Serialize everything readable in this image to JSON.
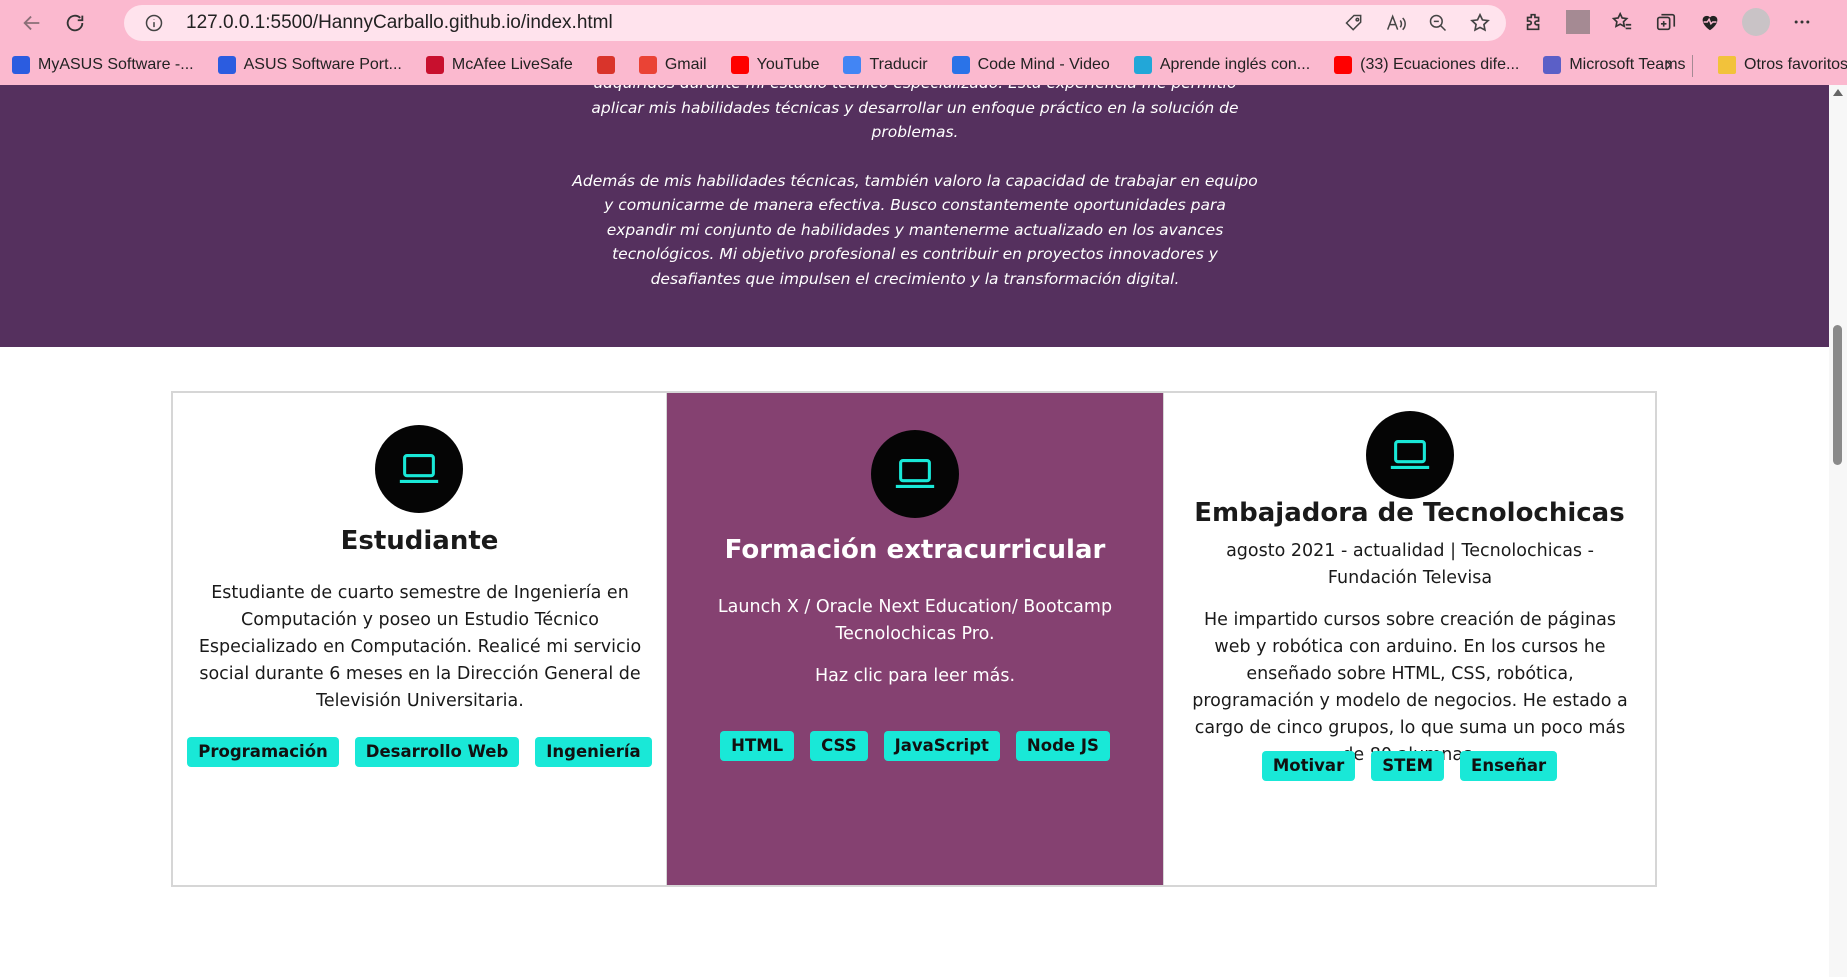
{
  "browser": {
    "url": "127.0.0.1:5500/HannyCarballo.github.io/index.html",
    "bookmarks": [
      {
        "label": "MyASUS Software -...",
        "color": "#2b5ce0"
      },
      {
        "label": "ASUS Software Port...",
        "color": "#2b5ce0"
      },
      {
        "label": "McAfee LiveSafe",
        "color": "#c8102e"
      },
      {
        "label": "",
        "color": "#d9342b"
      },
      {
        "label": "Gmail",
        "color": "#ea4335"
      },
      {
        "label": "YouTube",
        "color": "#ff0000"
      },
      {
        "label": "Traducir",
        "color": "#4285f4"
      },
      {
        "label": "Code Mind - Video",
        "color": "#2a73e8"
      },
      {
        "label": "Aprende inglés con...",
        "color": "#22a7d8"
      },
      {
        "label": "(33) Ecuaciones dife...",
        "color": "#ff0000"
      },
      {
        "label": "Microsoft Teams",
        "color": "#5b5fc7"
      }
    ],
    "other_favorites": "Otros favoritos"
  },
  "about": {
    "paragraph1_tail": "adquiridos durante mi estudio técnico especializado. Esta experiencia me permitió aplicar mis habilidades técnicas y desarrollar un enfoque práctico en la solución de problemas.",
    "paragraph2": "Además de mis habilidades técnicas, también valoro la capacidad de trabajar en equipo y comunicarme de manera efectiva. Busco constantemente oportunidades para expandir mi conjunto de habilidades y mantenerme actualizado en los avances tecnológicos. Mi objetivo profesional es contribuir en proyectos innovadores y desafiantes que impulsen el crecimiento y la transformación digital."
  },
  "cards": [
    {
      "title": "Estudiante",
      "description": "Estudiante de cuarto semestre de Ingeniería en Computación y poseo un Estudio Técnico Especializado en Computación. Realicé mi servicio social durante 6 meses en la Dirección General de Televisión Universitaria.",
      "tags": [
        "Programación",
        "Desarrollo Web",
        "Ingeniería"
      ],
      "icon": "laptop-icon"
    },
    {
      "title": "Formación extracurricular",
      "description": "Launch X / Oracle Next Education/ Bootcamp Tecnolochicas Pro.",
      "more": "Haz clic para leer más.",
      "tags": [
        "HTML",
        "CSS",
        "JavaScript",
        "Node JS"
      ],
      "icon": "laptop-icon"
    },
    {
      "title": "Embajadora de Tecnolochicas",
      "meta": "agosto 2021 - actualidad | Tecnolochicas - Fundación Televisa",
      "description": "He impartido cursos sobre creación de páginas web y robótica con arduino. En los cursos he enseñado sobre HTML, CSS, robótica, programación y modelo de negocios. He estado a cargo de cinco grupos, lo que suma un poco más de 80 alumnas.",
      "tags": [
        "Motivar",
        "STEM",
        "Enseñar"
      ],
      "icon": "laptop-icon"
    }
  ],
  "colors": {
    "chrome": "#fbb9cf",
    "about_bg": "#55305e",
    "card_highlight": "#854171",
    "tag_bg": "#19e8d7",
    "icon_color": "#19e8d7"
  }
}
